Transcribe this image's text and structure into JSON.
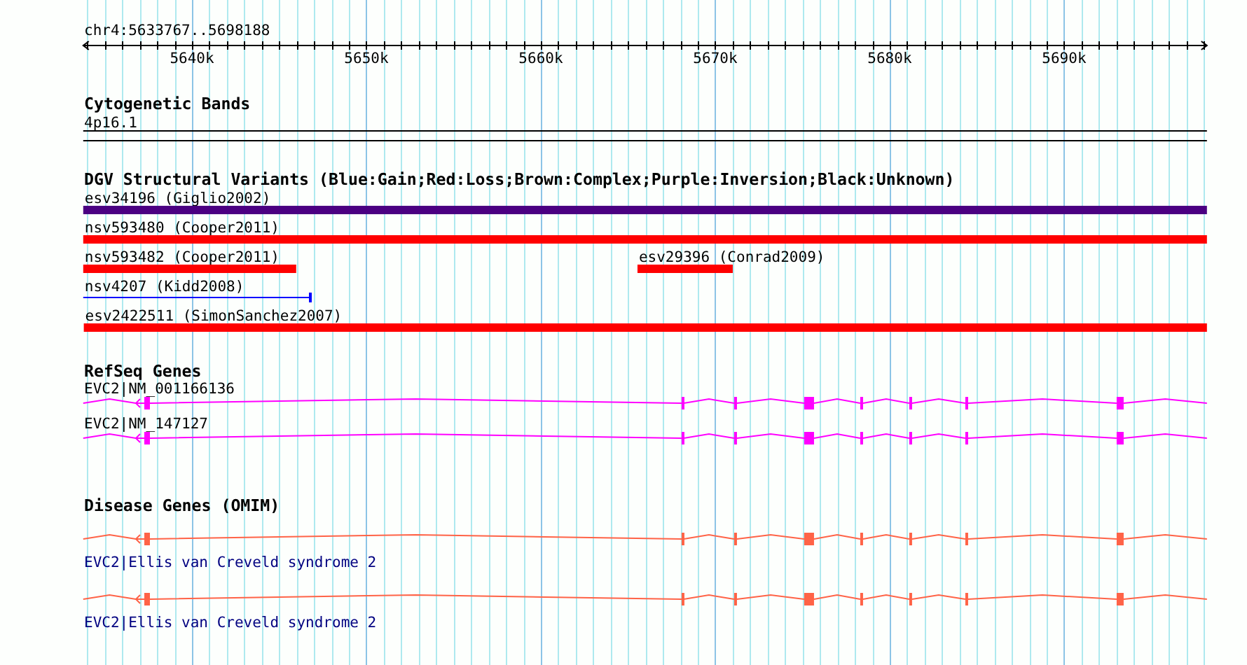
{
  "ruler": {
    "label": "chr4:5633767..5698188",
    "ticks": [
      {
        "label": "5640k"
      },
      {
        "label": "5650k"
      },
      {
        "label": "5660k"
      },
      {
        "label": "5670k"
      },
      {
        "label": "5680k"
      },
      {
        "label": "5690k"
      }
    ]
  },
  "tracks": [
    {
      "kind": "bands",
      "title": "Cytogenetic Bands",
      "band": "4p16.1"
    },
    {
      "kind": "variants",
      "title": "DGV Structural Variants (Blue:Gain;Red:Loss;Brown:Complex;Purple:Inversion;Black:Unknown)",
      "rows": [
        {
          "features": [
            {
              "kind": "bar",
              "label": "esv34196 (Giglio2002)",
              "color": "#4b0082"
            }
          ]
        },
        {
          "features": [
            {
              "kind": "bar",
              "label": "nsv593480 (Cooper2011)",
              "color": "#ff0000"
            }
          ]
        },
        {
          "features": [
            {
              "kind": "bar",
              "label": "nsv593482 (Cooper2011)",
              "color": "#ff0000"
            },
            {
              "kind": "bar",
              "label": "esv29396 (Conrad2009)",
              "color": "#ff0000"
            }
          ]
        },
        {
          "features": [
            {
              "kind": "line",
              "label": "nsv4207 (Kidd2008)",
              "color": "#0000ff"
            }
          ]
        },
        {
          "features": [
            {
              "kind": "bar",
              "label": "esv2422511 (SimonSanchez2007)",
              "color": "#ff0000"
            }
          ]
        }
      ]
    },
    {
      "kind": "genes",
      "title": "RefSeq Genes",
      "color": "#ff00ff",
      "genes": [
        {
          "label": "EVC2|NM_001166136",
          "reverse": true
        },
        {
          "label": "EVC2|NM_147127",
          "reverse": true
        }
      ]
    },
    {
      "kind": "disease_genes",
      "title": "Disease Genes (OMIM)",
      "color": "#ff6347",
      "genes": [
        {
          "label": "EVC2|Ellis van Creveld syndrome 2",
          "reverse": true
        },
        {
          "label": "EVC2|Ellis van Creveld syndrome 2",
          "reverse": true
        }
      ]
    }
  ]
}
